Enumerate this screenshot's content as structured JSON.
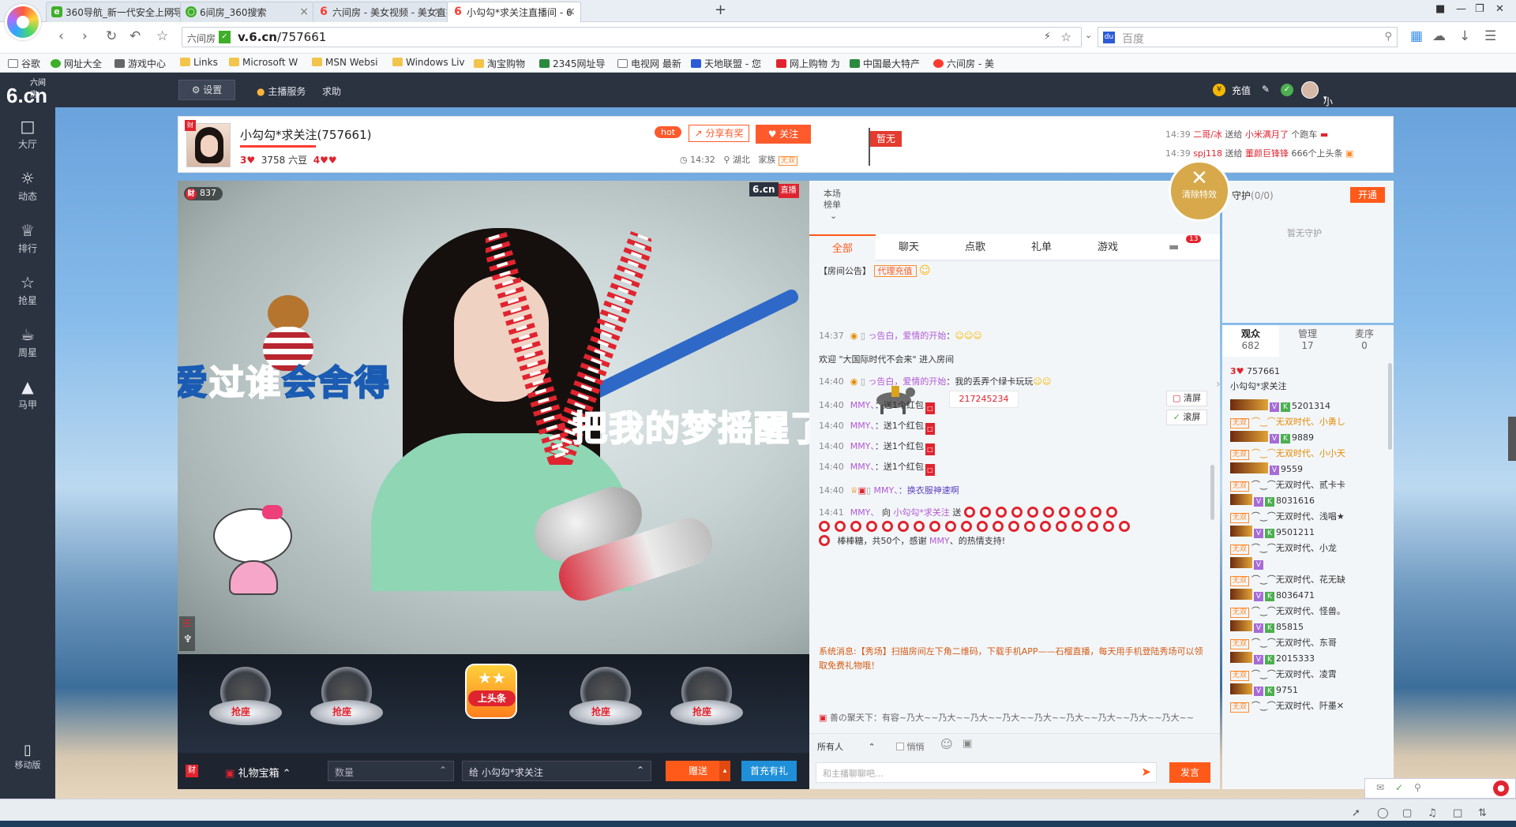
{
  "browser": {
    "tabs": [
      {
        "label": "360导航_新一代安全上网导航",
        "icon_color": "#3fae29"
      },
      {
        "label": "6间房_360搜索",
        "icon_color": "#3fae29"
      },
      {
        "label": "六间房 - 美女视频 - 美女直播",
        "icon_color": "#ff3b2f"
      },
      {
        "label": "小勾勾*求关注直播间 - 6",
        "icon_color": "#ff3b2f"
      }
    ],
    "address_site_label": "六间房",
    "address_host": "v.6.cn",
    "address_path": "/757661",
    "search_placeholder": "百度",
    "bookmarks": [
      "谷歌",
      "网址大全",
      "游戏中心",
      "Links",
      "Microsoft W",
      "MSN Websi",
      "Windows Liv",
      "淘宝购物",
      "2345网址导",
      "电视网 最新",
      "天地联盟 - 您",
      "网上购物 为",
      "中国最大特产",
      "六间房 - 美"
    ]
  },
  "site": {
    "logo_main": "6.cn",
    "logo_sub": "六间房",
    "settings_label": "设置",
    "header_links": [
      "主播服务",
      "求助"
    ],
    "recharge_label": "充值",
    "user_name": "小勾勾*求关注"
  },
  "leftnav": [
    {
      "label": "大厅",
      "icon": "tv-icon"
    },
    {
      "label": "动态",
      "icon": "compass-icon"
    },
    {
      "label": "排行",
      "icon": "crown-icon"
    },
    {
      "label": "抢星",
      "icon": "star-icon"
    },
    {
      "label": "周星",
      "icon": "cup-icon"
    },
    {
      "label": "马甲",
      "icon": "shirt-icon"
    }
  ],
  "mobile_label": "移动版",
  "anchor": {
    "name": "小勾勾*求关注(757661)",
    "level_hearts": "3",
    "beans": "3758 六豆",
    "fans_hearts": "4",
    "hot": "hot",
    "share_label": "分享有奖",
    "follow_label": "关注",
    "time": "14:32",
    "location": "湖北",
    "family_label": "家族",
    "family_tag": "无双",
    "flag_label": "暂无"
  },
  "gift_feed": [
    {
      "time": "14:39",
      "from": "二哥∕冰",
      "action": "送给",
      "to": "小米满月了",
      "gift": "个跑车"
    },
    {
      "time": "14:39",
      "from": "spj118",
      "action": "送给",
      "to": "董颜巨锋锋",
      "gift": "666个上头条"
    }
  ],
  "video": {
    "rich_count": "837",
    "live_logo": "6.cn",
    "live_tag": "直播",
    "lyric_line1_a": "很爱",
    "lyric_line1_b": "过谁",
    "lyric_line1_c": "会舍得",
    "lyric_line2": "把我的梦摇醒了"
  },
  "seats": {
    "grab_label": "抢座",
    "top_news_label": "上头条"
  },
  "giftbar": {
    "rich_icon": "财",
    "giftbox_label": "礼物宝箱",
    "quantity_placeholder": "数量",
    "target_label": "给 小勾勾*求关注",
    "send_label": "赠送",
    "recharge_label": "首充有礼"
  },
  "chat": {
    "rank_label_1": "本场",
    "rank_label_2": "榜单",
    "clear_effect": "清除特效",
    "tabs": [
      "全部",
      "聊天",
      "点歌",
      "礼单",
      "游戏"
    ],
    "car_count": "13",
    "notice_label": "【房间公告】",
    "notice_tag": "代理充值",
    "room_id": "217245234",
    "clear_label": "清屏",
    "scroll_label": "滚屏",
    "messages": [
      {
        "time": "14:37",
        "user": "っ告白，爱情的开始",
        "text": "："
      },
      {
        "time": "",
        "user": "",
        "text": "欢迎 \"大国际时代不会来\" 进入房间"
      },
      {
        "time": "14:40",
        "user": "っ告白，爱情的开始",
        "text": "：我的丢弄个绿卡玩玩"
      },
      {
        "time": "14:40",
        "user": "MMY、",
        "text": "：送1个红包"
      },
      {
        "time": "14:40",
        "user": "MMY、",
        "text": "：送1个红包"
      },
      {
        "time": "14:40",
        "user": "MMY、",
        "text": "：送1个红包"
      },
      {
        "time": "14:40",
        "user": "MMY、",
        "text": "：送1个红包"
      },
      {
        "time": "14:40",
        "user": "MMY、",
        "text": "：换衣服神速啊"
      }
    ],
    "gift_msg_time": "14:41",
    "gift_msg_from": "MMY、",
    "gift_msg_to": "小勾勾*求关注",
    "gift_msg_tail_a": "棒棒糖，共50个，感谢",
    "gift_msg_tail_user": "MMY",
    "gift_msg_tail_b": "、的热情支持!",
    "system_msg": "系统消息:【秀场】扫描房间左下角二维码，下载手机APP——石榴直播，每天用手机登陆秀场可以领取免费礼物哦！",
    "marquee": "善の聚天下：有容~乃大~~乃大~~乃大~~乃大~~乃大~~乃大~~乃大~~乃大~~乃大~~",
    "to_all": "所有人",
    "whisper": "悄悄",
    "input_placeholder": "和主播聊聊吧...",
    "post_label": "发言"
  },
  "guard": {
    "title": "守护",
    "count": "(0/0)",
    "open_label": "开通",
    "empty": "暂无守护"
  },
  "audience": {
    "tabs": [
      {
        "label": "观众",
        "count": "682"
      },
      {
        "label": "管理",
        "count": "17"
      },
      {
        "label": "麦序",
        "count": "0"
      }
    ],
    "host_hearts": "3",
    "host_id": "757661",
    "host_name": "小勾勾*求关注",
    "items": [
      {
        "id": "5201314",
        "name": "⌒‿⌒无双时代、小勇し",
        "gold": true
      },
      {
        "id": "9889",
        "name": "⌒‿⌒无双时代、小小天",
        "gold": true
      },
      {
        "id": "9559",
        "name": "⌒‿⌒无双时代、贰卡卡",
        "gold": false
      },
      {
        "id": "8031616",
        "name": "⌒‿⌒无双时代、浅唱★",
        "gold": false
      },
      {
        "id": "9501211",
        "name": "⌒‿⌒无双时代、小龙",
        "gold": false
      },
      {
        "id": "",
        "name": "⌒‿⌒无双时代、花无缺",
        "gold": false
      },
      {
        "id": "8036471",
        "name": "⌒‿⌒无双时代、怪兽。",
        "gold": false
      },
      {
        "id": "85815",
        "name": "⌒‿⌒无双时代、东哥",
        "gold": false
      },
      {
        "id": "2015333",
        "name": "⌒‿⌒无双时代、凌霄",
        "gold": false
      },
      {
        "id": "9751",
        "name": "⌒‿⌒无双时代、阡墨✕",
        "gold": false
      }
    ],
    "tag": "无双"
  },
  "colors": {
    "accent": "#ff5a1a",
    "brand_red": "#e0242f",
    "dark": "#2b3341"
  }
}
